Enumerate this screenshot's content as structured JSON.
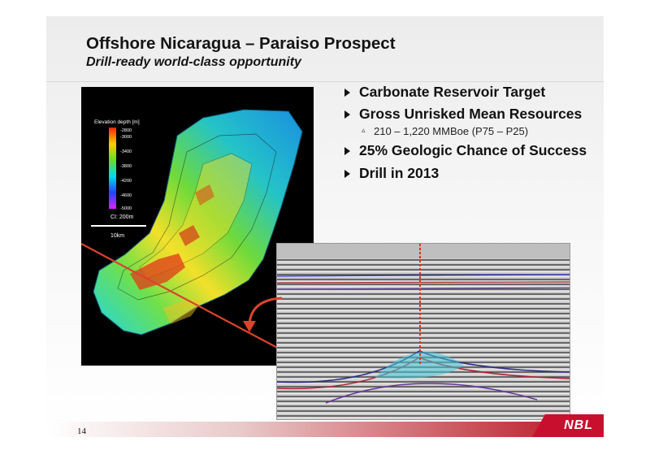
{
  "slide": {
    "title": "Offshore Nicaragua – Paraiso Prospect",
    "subtitle": "Drill-ready world-class opportunity",
    "page_number": "14",
    "logo_text": "NBL",
    "accent_color": "#c8102e"
  },
  "bullets": [
    {
      "text": "Carbonate Reservoir Target"
    },
    {
      "text": "Gross Unrisked Mean Resources",
      "sub": "210 – 1,220 MMBoe (P75 – P25)"
    },
    {
      "text": "25% Geologic Chance of Success"
    },
    {
      "text": "Drill in 2013"
    }
  ],
  "map": {
    "legend_title": "Elevation depth [m]",
    "legend_ticks": [
      "-2800",
      "-3000",
      "-3400",
      "-3800",
      "-4200",
      "-4600",
      "-5000"
    ],
    "contour_interval": "CI: 200m",
    "scale_label": "10km"
  }
}
